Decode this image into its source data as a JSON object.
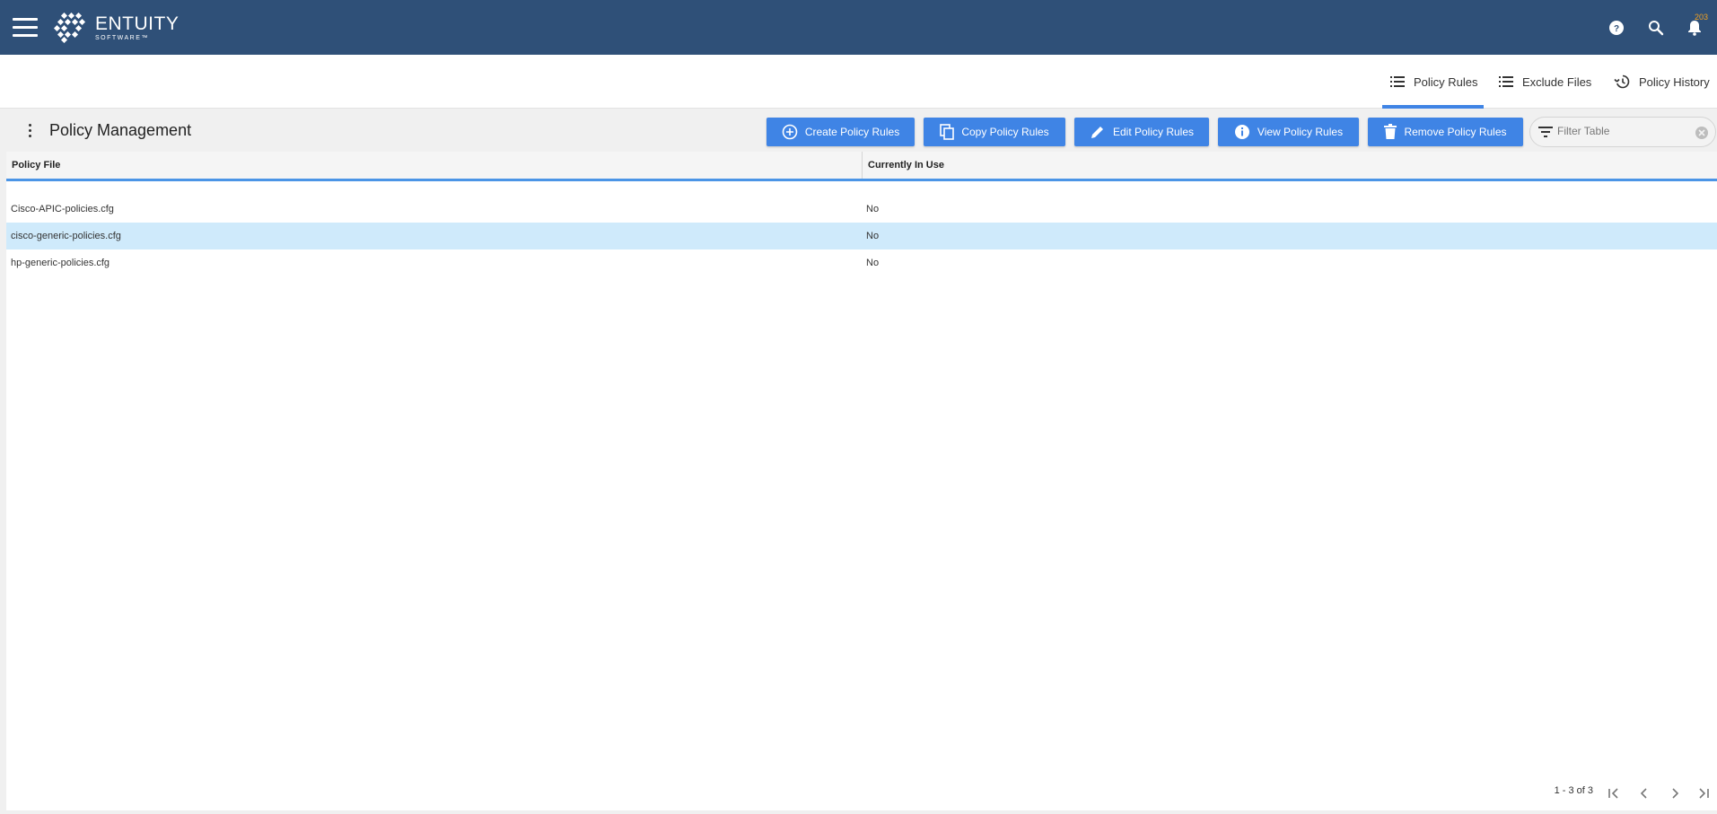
{
  "header": {
    "brand_name": "ENTUITY",
    "brand_sub": "SOFTWARE™",
    "notification_count": "203",
    "colors": {
      "bar": "#2f5078",
      "accent": "#3f84e5"
    },
    "icons": [
      "menu-icon",
      "help-icon",
      "search-icon",
      "bell-icon"
    ]
  },
  "tabs": [
    {
      "label": "Policy Rules",
      "icon": "list-icon",
      "active": true
    },
    {
      "label": "Exclude Files",
      "icon": "list-icon",
      "active": false
    },
    {
      "label": "Policy History",
      "icon": "history-icon",
      "active": false
    }
  ],
  "toolbar": {
    "title": "Policy Management",
    "buttons": [
      {
        "label": "Create Policy Rules",
        "icon": "add-circle-icon"
      },
      {
        "label": "Copy Policy Rules",
        "icon": "copy-icon"
      },
      {
        "label": "Edit Policy Rules",
        "icon": "pencil-icon"
      },
      {
        "label": "View Policy Rules",
        "icon": "info-icon"
      },
      {
        "label": "Remove Policy Rules",
        "icon": "trash-icon"
      }
    ],
    "filter_placeholder": "Filter Table"
  },
  "table": {
    "columns": [
      "Policy File",
      "Currently In Use"
    ],
    "rows": [
      {
        "policy_file": "Cisco-APIC-policies.cfg",
        "in_use": "No",
        "selected": false
      },
      {
        "policy_file": "cisco-generic-policies.cfg",
        "in_use": "No",
        "selected": true
      },
      {
        "policy_file": "hp-generic-policies.cfg",
        "in_use": "No",
        "selected": false
      }
    ],
    "pagination": "1 - 3 of 3"
  }
}
